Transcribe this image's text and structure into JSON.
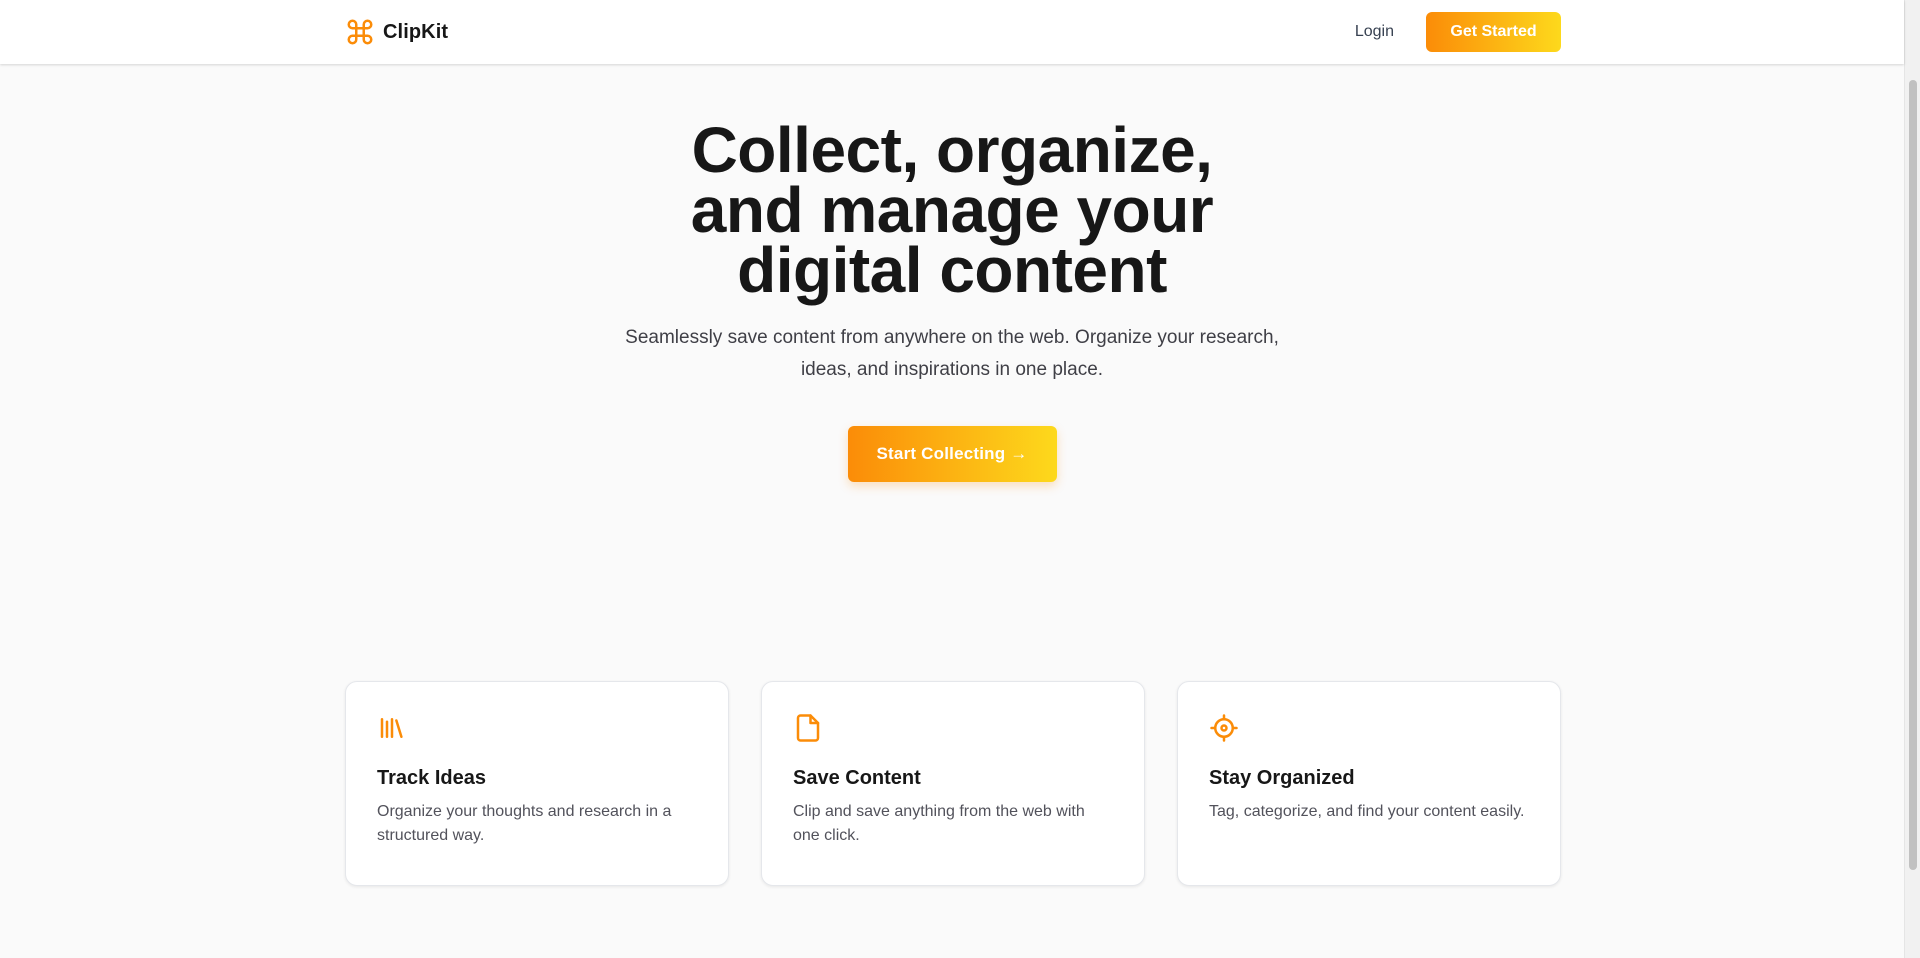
{
  "brand": {
    "name": "ClipKit",
    "icon": "command-icon",
    "accent": "#fb8c08"
  },
  "nav": {
    "login_label": "Login",
    "cta_label": "Get Started"
  },
  "hero": {
    "title": "Collect, organize, and manage your digital content",
    "subtitle": "Seamlessly save content from anywhere on the web. Organize your research, ideas, and inspirations in one place.",
    "cta_label": "Start Collecting →"
  },
  "features": [
    {
      "icon": "library-icon",
      "title": "Track Ideas",
      "description": "Organize your thoughts and research in a structured way."
    },
    {
      "icon": "file-icon",
      "title": "Save Content",
      "description": "Clip and save anything from the web with one click."
    },
    {
      "icon": "target-icon",
      "title": "Stay Organized",
      "description": "Tag, categorize, and find your content easily."
    }
  ],
  "colors": {
    "gradient_start": "#fb8c08",
    "gradient_end": "#fdd91c",
    "background": "#fafafa"
  }
}
